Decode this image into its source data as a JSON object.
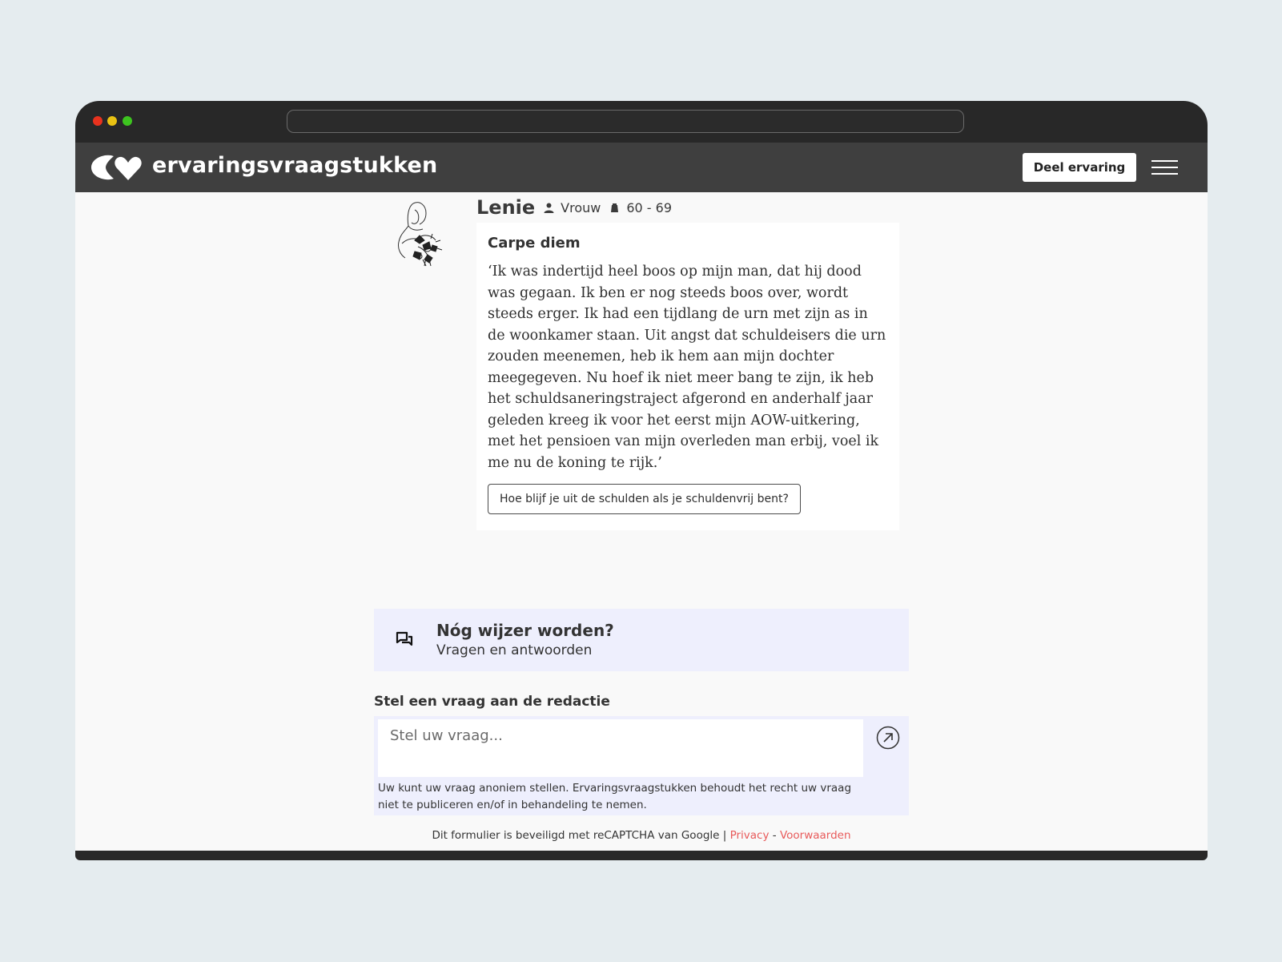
{
  "site": {
    "brand": "ervaringsvraagstukken",
    "share_button": "Deel ervaring"
  },
  "author": {
    "name": "Lenie",
    "gender": "Vrouw",
    "age_range": "60 - 69"
  },
  "story": {
    "title": "Carpe diem",
    "text": "‘Ik was indertijd heel boos op mijn man, dat hij dood was gegaan. Ik ben er nog steeds boos over, wordt steeds erger. Ik had een tijdlang de urn met zijn as in de woonkamer staan. Uit angst dat schuldeisers die urn zouden meenemen, heb ik hem aan mijn dochter meegegeven. Nu hoef ik niet meer bang te zijn, ik heb het schuldsaneringstraject afgerond en anderhalf jaar geleden kreeg ik voor het eerst mijn AOW-uitkering, met het pensioen van mijn overleden man erbij, voel ik me nu de koning te rijk.’",
    "tag_button": "Hoe blijf je uit de schulden als je schuldenvrij bent?"
  },
  "qa": {
    "title": "Nóg wijzer worden?",
    "subtitle": "Vragen en antwoorden"
  },
  "ask": {
    "label": "Stel een vraag aan de redactie",
    "placeholder": "Stel uw vraag...",
    "note": "Uw kunt uw vraag anoniem stellen. Ervaringsvraagstukken behoudt het recht uw vraag niet te publiceren en/of in behandeling te nemen."
  },
  "footer": {
    "recaptcha_text": "Dit formulier is beveiligd met reCAPTCHA van Google |",
    "privacy_link": "Privacy",
    "separator": "-",
    "terms_link": "Voorwaarden"
  },
  "colors": {
    "chrome": "#282828",
    "nav": "#3f3f3f",
    "accent_link": "#e85a5a",
    "qa_background": "#eeeffd"
  },
  "icons": {
    "logo": "heart-logo-icon",
    "person": "person-icon",
    "age": "age-icon",
    "qa": "chat-bubbles-icon",
    "submit": "arrow-up-right-circle-icon"
  }
}
